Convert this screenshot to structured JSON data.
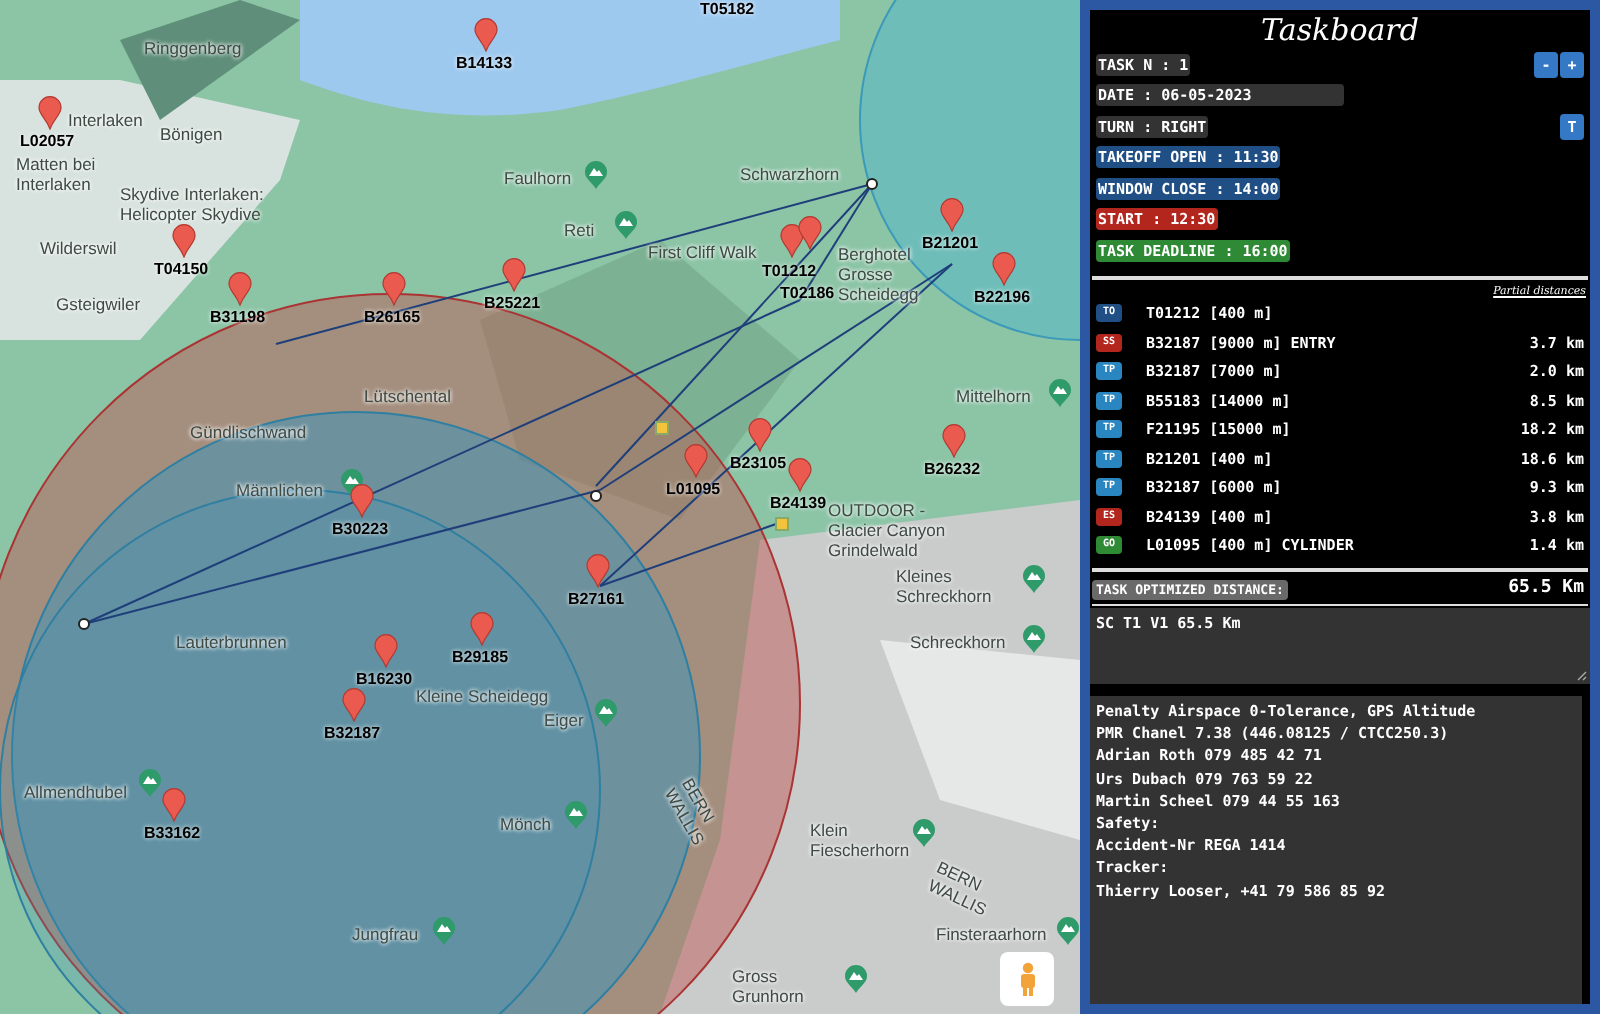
{
  "map": {
    "places": [
      {
        "label": "Ringgenberg"
      },
      {
        "label": "Interlaken"
      },
      {
        "label": "Matten bei Interlaken"
      },
      {
        "label": "Bönigen"
      },
      {
        "label": "Skydive Interlaken: Helicopter Skydive"
      },
      {
        "label": "Wilderswil"
      },
      {
        "label": "Gsteigwiler"
      },
      {
        "label": "Faulhorn"
      },
      {
        "label": "Reti"
      },
      {
        "label": "First Cliff Walk"
      },
      {
        "label": "Berghotel Grosse Scheidegg"
      },
      {
        "label": "Schwarzhorn"
      },
      {
        "label": "Mittelhorn"
      },
      {
        "label": "Lütschental"
      },
      {
        "label": "Gündlischwand"
      },
      {
        "label": "Männlichen"
      },
      {
        "label": "OUTDOOR - Glacier Canyon Grindelwald"
      },
      {
        "label": "Kleines Schreckhorn"
      },
      {
        "label": "Schreckhorn"
      },
      {
        "label": "Lauterbrunnen"
      },
      {
        "label": "Kleine Scheidegg"
      },
      {
        "label": "Eiger"
      },
      {
        "label": "Allmendhubel"
      },
      {
        "label": "Mönch"
      },
      {
        "label": "BERN WALLIS"
      },
      {
        "label": "Klein Fiescherhorn"
      },
      {
        "label": "BERN WALLIS"
      },
      {
        "label": "Finsteraarhorn"
      },
      {
        "label": "Jungfrau"
      },
      {
        "label": "Gross Grunhorn"
      }
    ],
    "waypoints": [
      {
        "label": "T05182"
      },
      {
        "label": "B14133"
      },
      {
        "label": "L02057"
      },
      {
        "label": "T04150"
      },
      {
        "label": "B31198"
      },
      {
        "label": "B26165"
      },
      {
        "label": "B25221"
      },
      {
        "label": "T01212"
      },
      {
        "label": "T02186"
      },
      {
        "label": "B21201"
      },
      {
        "label": "B22196"
      },
      {
        "label": "B23105"
      },
      {
        "label": "L01095"
      },
      {
        "label": "B24139"
      },
      {
        "label": "B26232"
      },
      {
        "label": "B30223"
      },
      {
        "label": "B27161"
      },
      {
        "label": "B29185"
      },
      {
        "label": "B16230"
      },
      {
        "label": "B32187"
      },
      {
        "label": "B33162"
      }
    ]
  },
  "taskboard": {
    "title": "Taskboard",
    "fields": [
      {
        "text": "TASK N : 1",
        "kind": "label",
        "color": "#333333",
        "buttons": [
          "-",
          "+"
        ]
      },
      {
        "text": "DATE : 06-05-2023",
        "kind": "input",
        "color": "#333333"
      },
      {
        "text": "TURN : RIGHT",
        "kind": "label",
        "color": "#333333",
        "buttons": [
          "T"
        ]
      },
      {
        "text": "TAKEOFF OPEN : 11:30",
        "kind": "label",
        "color": "#1f4f85"
      },
      {
        "text": "WINDOW CLOSE : 14:00",
        "kind": "label",
        "color": "#1f4f85"
      },
      {
        "text": "START : 12:30",
        "kind": "label",
        "color": "#b3261e"
      },
      {
        "text": "TASK DEADLINE : 16:00",
        "kind": "label",
        "color": "#2f8a35"
      }
    ],
    "partial_distances_heading": "Partial distances",
    "turnpoints": [
      {
        "type": "TO",
        "color": "#1f4f85",
        "name": "T01212 [400 m]"
      },
      {
        "type": "SS",
        "color": "#b3261e",
        "name": "B32187 [9000 m] ENTRY",
        "distance": "3.7 km"
      },
      {
        "type": "TP",
        "color": "#2a86c0",
        "name": "B32187 [7000 m]",
        "distance": "2.0 km"
      },
      {
        "type": "TP",
        "color": "#2a86c0",
        "name": "B55183 [14000 m]",
        "distance": "8.5 km"
      },
      {
        "type": "TP",
        "color": "#2a86c0",
        "name": "F21195 [15000 m]",
        "distance": "18.2 km"
      },
      {
        "type": "TP",
        "color": "#2a86c0",
        "name": "B21201 [400 m]",
        "distance": "18.6 km"
      },
      {
        "type": "TP",
        "color": "#2a86c0",
        "name": "B32187 [6000 m]",
        "distance": "9.3 km"
      },
      {
        "type": "ES",
        "color": "#b3261e",
        "name": "B24139 [400 m]",
        "distance": "3.8 km"
      },
      {
        "type": "GO",
        "color": "#2f8a35",
        "name": "L01095 [400 m] CYLINDER",
        "distance": "1.4 km"
      }
    ],
    "optimized_distance": {
      "label": "TASK OPTIMIZED DISTANCE:",
      "value": "65.5 Km"
    },
    "task_note": "SC T1 V1 65.5 Km",
    "info_lines": [
      "Penalty Airspace 0-Tolerance, GPS Altitude",
      "PMR Chanel 7.38 (446.08125 / CTCC250.3)",
      "Adrian Roth 079 485 42 71",
      "Urs Dubach 079 763 59 22",
      "Martin Scheel 079 44 55 163",
      "Safety:",
      "Accident-Nr REGA 1414",
      "Tracker:",
      "Thierry Looser, +41 79 586 85 92"
    ]
  }
}
